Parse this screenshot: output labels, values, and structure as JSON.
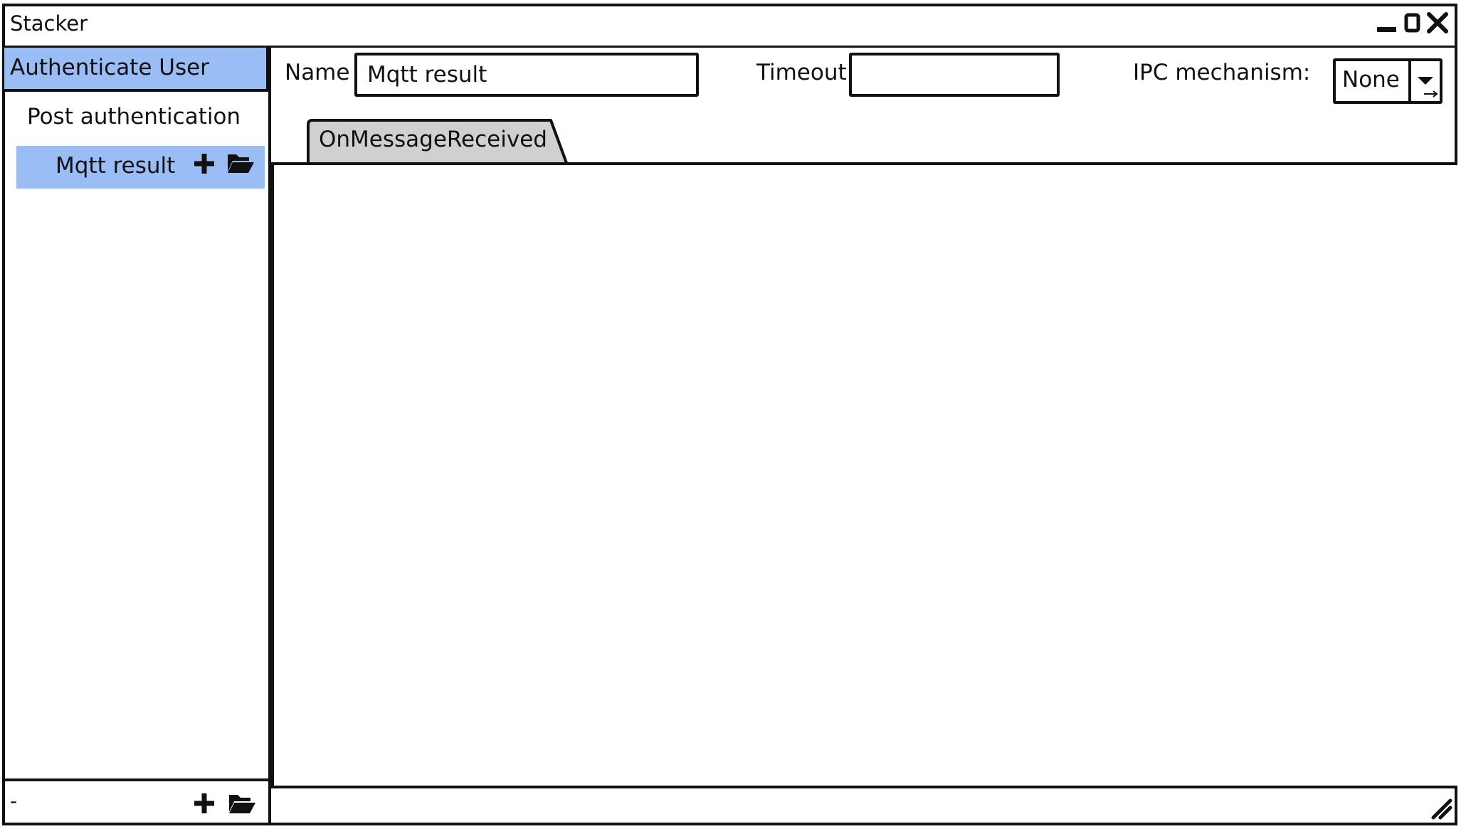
{
  "window": {
    "title": "Stacker",
    "controls": {
      "minimize_icon": "minimize-icon",
      "maximize_icon": "maximize-icon",
      "close_icon": "close-icon"
    }
  },
  "sidebar": {
    "items": [
      {
        "label": "Authenticate User",
        "selected": true
      },
      {
        "label": "Post authentication",
        "selected": false
      },
      {
        "label": "Mqtt result",
        "selected": true,
        "actions": [
          "plus-icon",
          "folder-open-icon"
        ]
      }
    ],
    "footer": {
      "label": "-",
      "actions": [
        "plus-icon",
        "folder-open-icon"
      ]
    }
  },
  "form": {
    "name_label": "Name",
    "name_value": "Mqtt result",
    "timeout_label": "Timeout",
    "timeout_value": "",
    "ipc_label": "IPC mechanism:",
    "ipc_value": "None"
  },
  "tabs": [
    {
      "label": "OnMessageReceived",
      "active": true
    }
  ],
  "colors": {
    "selection": "#9bbdf5",
    "border": "#111111",
    "tab_fill": "#d0d0d0"
  }
}
